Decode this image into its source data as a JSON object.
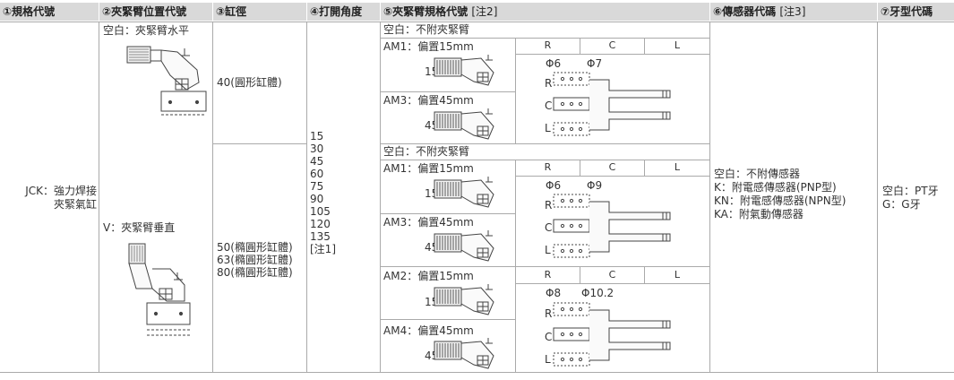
{
  "headers": [
    {
      "num": "①",
      "text": "規格代號",
      "note": ""
    },
    {
      "num": "②",
      "text": "夾緊臂位置代號",
      "note": ""
    },
    {
      "num": "③",
      "text": "缸徑",
      "note": ""
    },
    {
      "num": "④",
      "text": "打開角度",
      "note": ""
    },
    {
      "num": "⑤",
      "text": "夾緊臂規格代號",
      "note": "[注2]"
    },
    {
      "num": "⑥",
      "text": "傳感器代碼",
      "note": "[注3]"
    },
    {
      "num": "⑦",
      "text": "牙型代碼",
      "note": ""
    }
  ],
  "spec_code": {
    "line1": "JCK：強力焊接",
    "line2": "夾緊氣缸"
  },
  "arm_position": {
    "horizontal": "空白：夾緊臂水平",
    "vertical": "V：夾緊臂垂直"
  },
  "bore": {
    "small": "40(圓形缸體)",
    "large": [
      "50(橢圓形缸體)",
      "63(橢圓形缸體)",
      "80(橢圓形缸體)"
    ]
  },
  "angles": [
    "15",
    "30",
    "45",
    "60",
    "75",
    "90",
    "105",
    "120",
    "135",
    "[注1]"
  ],
  "arm_sections": [
    {
      "blank": "空白：不附夾緊臂",
      "opt1": {
        "label": "AM1：偏置15mm",
        "num": "15"
      },
      "opt2": {
        "label": "AM3：偏置45mm",
        "num": "45"
      },
      "rcl": [
        "R",
        "C",
        "L"
      ],
      "dims": [
        "Φ6",
        "Φ7"
      ]
    },
    {
      "blank": "空白：不附夾緊臂",
      "opt1": {
        "label": "AM1：偏置15mm",
        "num": "15"
      },
      "opt2": {
        "label": "AM3：偏置45mm",
        "num": "45"
      },
      "rcl": [
        "R",
        "C",
        "L"
      ],
      "dims": [
        "Φ6",
        "Φ9"
      ]
    },
    {
      "blank": "",
      "opt1": {
        "label": "AM2：偏置15mm",
        "num": "15"
      },
      "opt2": {
        "label": "AM4：偏置45mm",
        "num": "45"
      },
      "rcl": [
        "R",
        "C",
        "L"
      ],
      "dims": [
        "Φ8",
        "Φ10.2"
      ]
    }
  ],
  "sensor": [
    "空白：不附傳感器",
    "K：附電感傳感器(PNP型)",
    "KN：附電感傳感器(NPN型)",
    "KA：附氣動傳感器"
  ],
  "thread": [
    "空白：PT牙",
    "G：G牙"
  ]
}
